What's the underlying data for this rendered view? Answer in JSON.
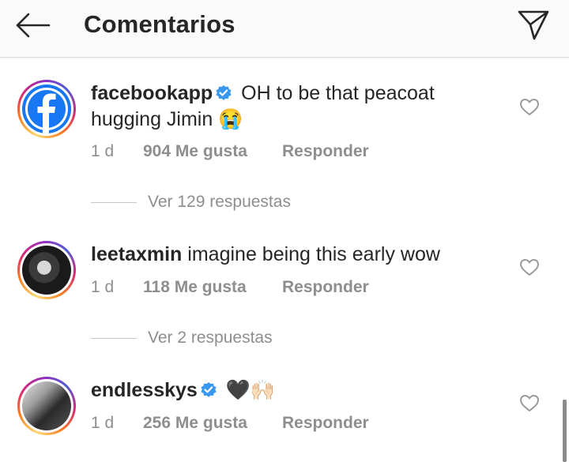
{
  "header": {
    "title": "Comentarios",
    "back_icon": "arrow-left-icon",
    "send_icon": "paper-plane-icon"
  },
  "comments": [
    {
      "username": "facebookapp",
      "verified": true,
      "text": "OH to be that peacoat hugging Jimin 😭",
      "time": "1 d",
      "likes": "904 Me gusta",
      "reply_label": "Responder",
      "view_replies": "Ver 129 respuestas"
    },
    {
      "username": "leetaxmin",
      "verified": false,
      "text": "imagine being this early wow",
      "time": "1 d",
      "likes": "118 Me gusta",
      "reply_label": "Responder",
      "view_replies": "Ver 2 respuestas"
    },
    {
      "username": "endlesskys",
      "verified": true,
      "text": "🖤🙌🏻",
      "time": "1 d",
      "likes": "256 Me gusta",
      "reply_label": "Responder"
    }
  ],
  "colors": {
    "verified_blue": "#3897f0",
    "muted_text": "#8e8e8e",
    "facebook_blue": "#1877f2"
  }
}
